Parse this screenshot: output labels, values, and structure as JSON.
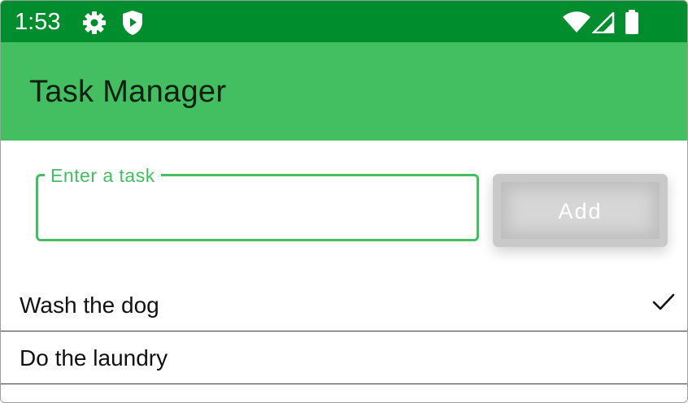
{
  "status_bar": {
    "time": "1:53",
    "icons": [
      "gear-icon",
      "shield-play-icon",
      "wifi-icon",
      "signal-icon",
      "battery-icon"
    ]
  },
  "app_bar": {
    "title": "Task Manager"
  },
  "new_task": {
    "label": "Enter a task",
    "value": "",
    "button_label": "Add"
  },
  "tasks": [
    {
      "text": "Wash the dog",
      "done": true
    },
    {
      "text": "Do the laundry",
      "done": false
    }
  ],
  "colors": {
    "status_bar": "#008d2e",
    "app_bar": "#43be60",
    "accent": "#43be60",
    "button_disabled": "#c9c9c9"
  }
}
